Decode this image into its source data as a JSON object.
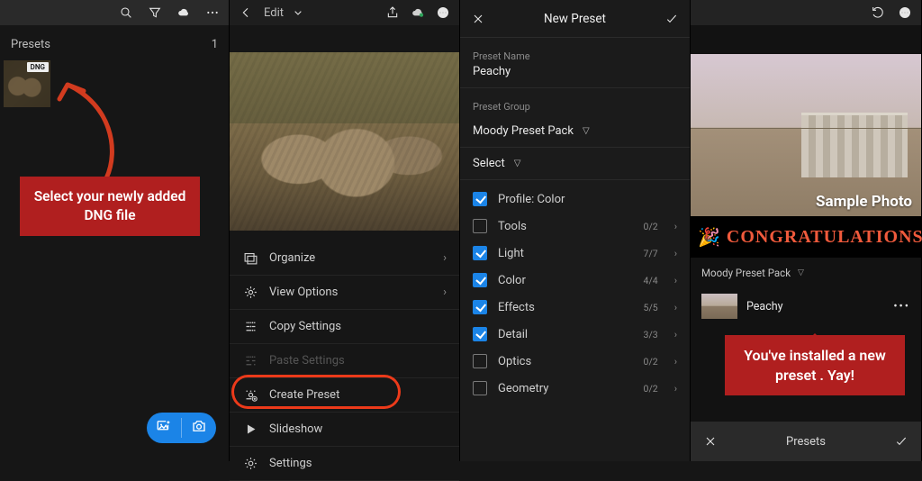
{
  "panel1": {
    "header": "Presets",
    "count": "1",
    "dng_badge": "DNG",
    "callout": "Select your newly added DNG file"
  },
  "panel2": {
    "back_label": "Edit",
    "menu": [
      {
        "label": "Organize",
        "chevron": true
      },
      {
        "label": "View Options",
        "chevron": true
      },
      {
        "label": "Copy Settings",
        "chevron": false
      },
      {
        "label": "Paste Settings",
        "chevron": false,
        "disabled": true
      },
      {
        "label": "Create Preset",
        "chevron": false,
        "ring": true
      },
      {
        "label": "Slideshow",
        "chevron": false
      },
      {
        "label": "Settings",
        "chevron": false
      }
    ]
  },
  "panel3": {
    "title": "New Preset",
    "name_label": "Preset Name",
    "name_value": "Peachy",
    "group_label": "Preset Group",
    "group_value": "Moody Preset Pack",
    "select_label": "Select",
    "options": [
      {
        "label": "Profile: Color",
        "checked": true,
        "count": "",
        "chevron": false
      },
      {
        "label": "Tools",
        "checked": false,
        "count": "0/2",
        "chevron": true
      },
      {
        "label": "Light",
        "checked": true,
        "count": "7/7",
        "chevron": true
      },
      {
        "label": "Color",
        "checked": true,
        "count": "4/4",
        "chevron": true
      },
      {
        "label": "Effects",
        "checked": true,
        "count": "5/5",
        "chevron": true
      },
      {
        "label": "Detail",
        "checked": true,
        "count": "3/3",
        "chevron": true
      },
      {
        "label": "Optics",
        "checked": false,
        "count": "0/2",
        "chevron": true
      },
      {
        "label": "Geometry",
        "checked": false,
        "count": "0/2",
        "chevron": true
      }
    ]
  },
  "panel4": {
    "sample_label": "Sample Photo",
    "congrats": "CONGRATULATIONS",
    "group_value": "Moody Preset Pack",
    "preset_name": "Peachy",
    "callout": "You've installed a new preset . Yay!",
    "footer_label": "Presets"
  }
}
